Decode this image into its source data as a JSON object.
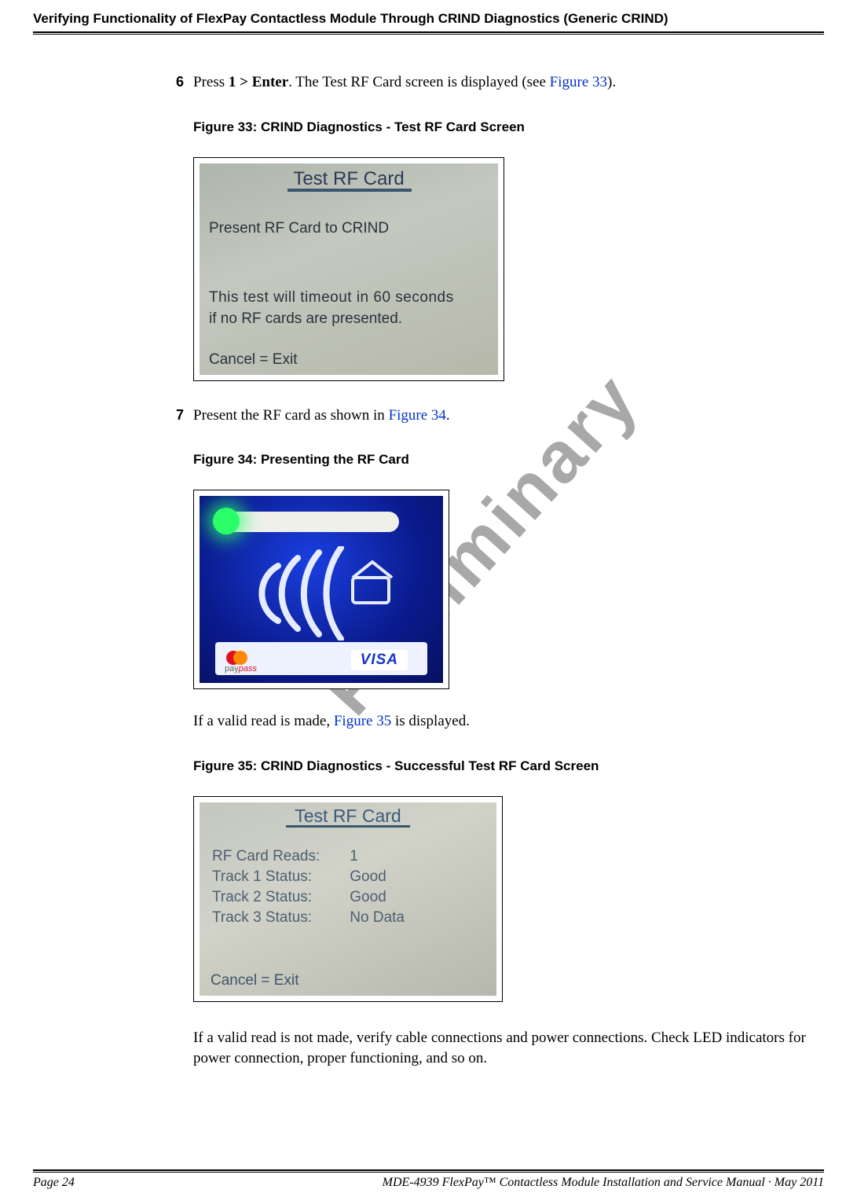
{
  "header": {
    "running_head": "Verifying Functionality of FlexPay Contactless Module Through CRIND Diagnostics (Generic CRIND)"
  },
  "watermark": "Preliminary",
  "steps": {
    "s6": {
      "num": "6",
      "pre": "Press ",
      "bold": "1 > Enter",
      "post": ". The Test RF Card screen is displayed (see ",
      "link": "Figure 33",
      "tail": ")."
    },
    "s7": {
      "num": "7",
      "pre": "Present the RF card as shown in ",
      "link": "Figure 34",
      "tail": "."
    },
    "p_valid_pre": "If a valid read is made, ",
    "p_valid_link": "Figure 35",
    "p_valid_post": " is displayed.",
    "p_invalid": "If a valid read is not made, verify cable connections and power connections. Check LED indicators for power connection, proper functioning, and so on."
  },
  "figures": {
    "f33": {
      "caption": "Figure 33: CRIND Diagnostics - Test RF Card Screen",
      "screen": {
        "title": "Test RF Card",
        "line1": "Present RF Card to CRIND",
        "line2": "This test will timeout in 60 seconds",
        "line3": "if no RF cards are presented.",
        "cancel": "Cancel = Exit"
      }
    },
    "f34": {
      "caption": "Figure 34: Presenting the RF Card",
      "mc_label": "MasterCard",
      "pay": "pay",
      "pass": "pass",
      "visa": "VISA"
    },
    "f35": {
      "caption": "Figure 35: CRIND Diagnostics - Successful Test RF Card Screen",
      "screen": {
        "title": "Test RF Card",
        "rows": {
          "r1l": "RF Card Reads:",
          "r1v": "1",
          "r2l": "Track 1 Status:",
          "r2v": "Good",
          "r3l": "Track 2 Status:",
          "r3v": "Good",
          "r4l": "Track 3 Status:",
          "r4v": "No Data"
        },
        "cancel": "Cancel = Exit"
      }
    }
  },
  "footer": {
    "page": "Page 24",
    "doc": "MDE-4939 FlexPay™ Contactless Module Installation and Service Manual · May 2011"
  }
}
